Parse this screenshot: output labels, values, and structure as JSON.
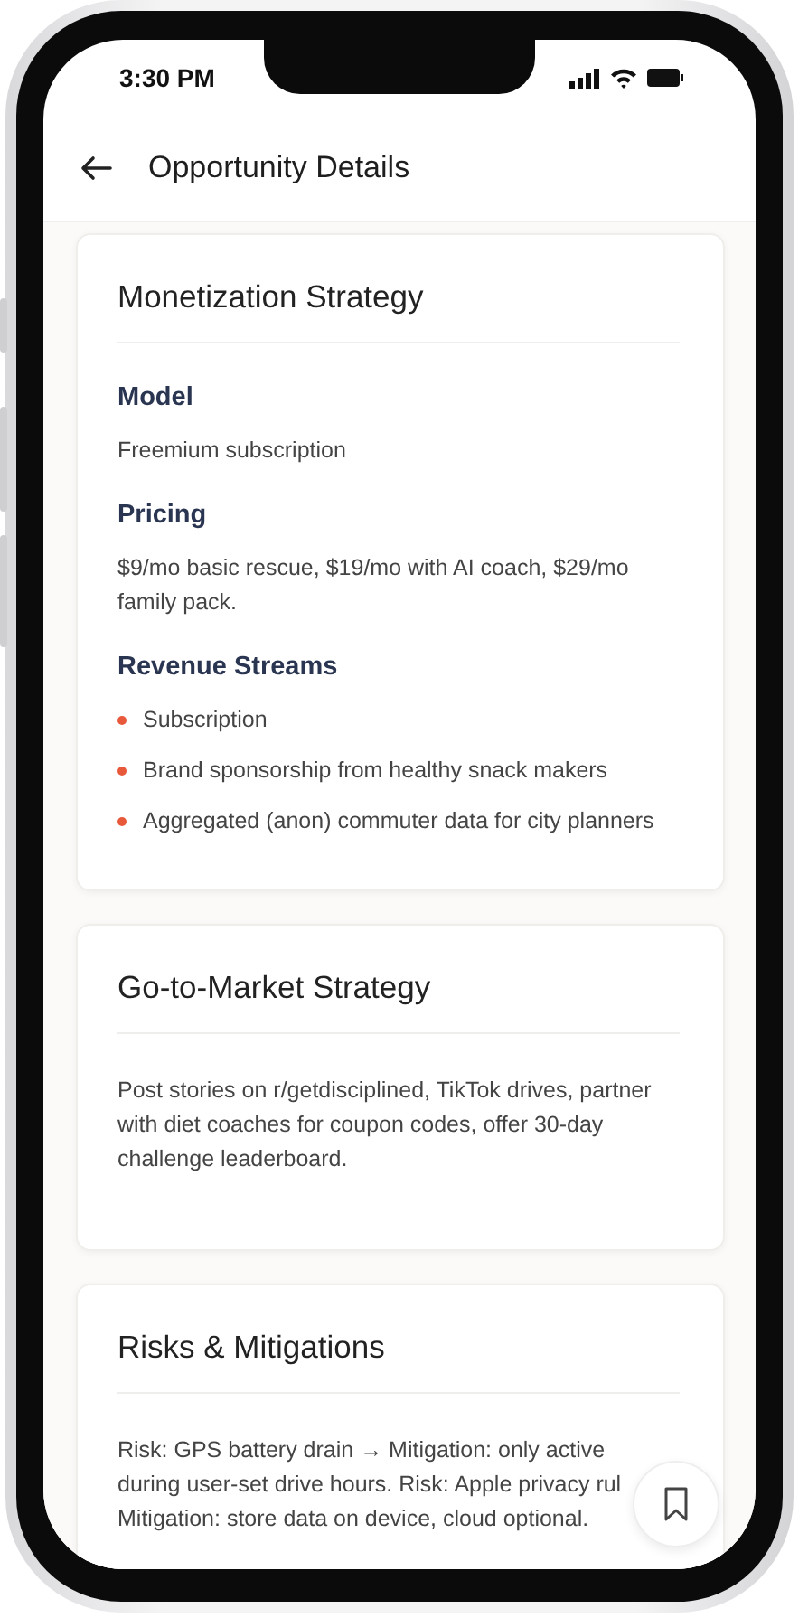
{
  "status_bar": {
    "time": "3:30 PM"
  },
  "header": {
    "title": "Opportunity Details"
  },
  "sections": [
    {
      "title": "Monetization Strategy",
      "blocks": [
        {
          "kind": "subsection",
          "heading": "Model",
          "text": "Freemium subscription"
        },
        {
          "kind": "subsection",
          "heading": "Pricing",
          "text": "$9/mo basic rescue, $19/mo with AI coach, $29/mo family pack."
        },
        {
          "kind": "list",
          "heading": "Revenue Streams",
          "items": [
            "Subscription",
            "Brand sponsorship from healthy snack makers",
            "Aggregated (anon) commuter data for city planners"
          ]
        }
      ]
    },
    {
      "title": "Go-to-Market Strategy",
      "blocks": [
        {
          "kind": "paragraph",
          "text": "Post stories on r/getdisciplined, TikTok drives, partner with diet coaches for coupon codes, offer 30-day challenge leaderboard."
        }
      ]
    },
    {
      "title": "Risks & Mitigations",
      "blocks": [
        {
          "kind": "lines",
          "lines": [
            "Risk: GPS battery drain → Mitigation: only active",
            "during user-set drive hours. Risk: Apple privacy rul",
            "Mitigation: store data on device, cloud optional."
          ]
        }
      ]
    }
  ]
}
